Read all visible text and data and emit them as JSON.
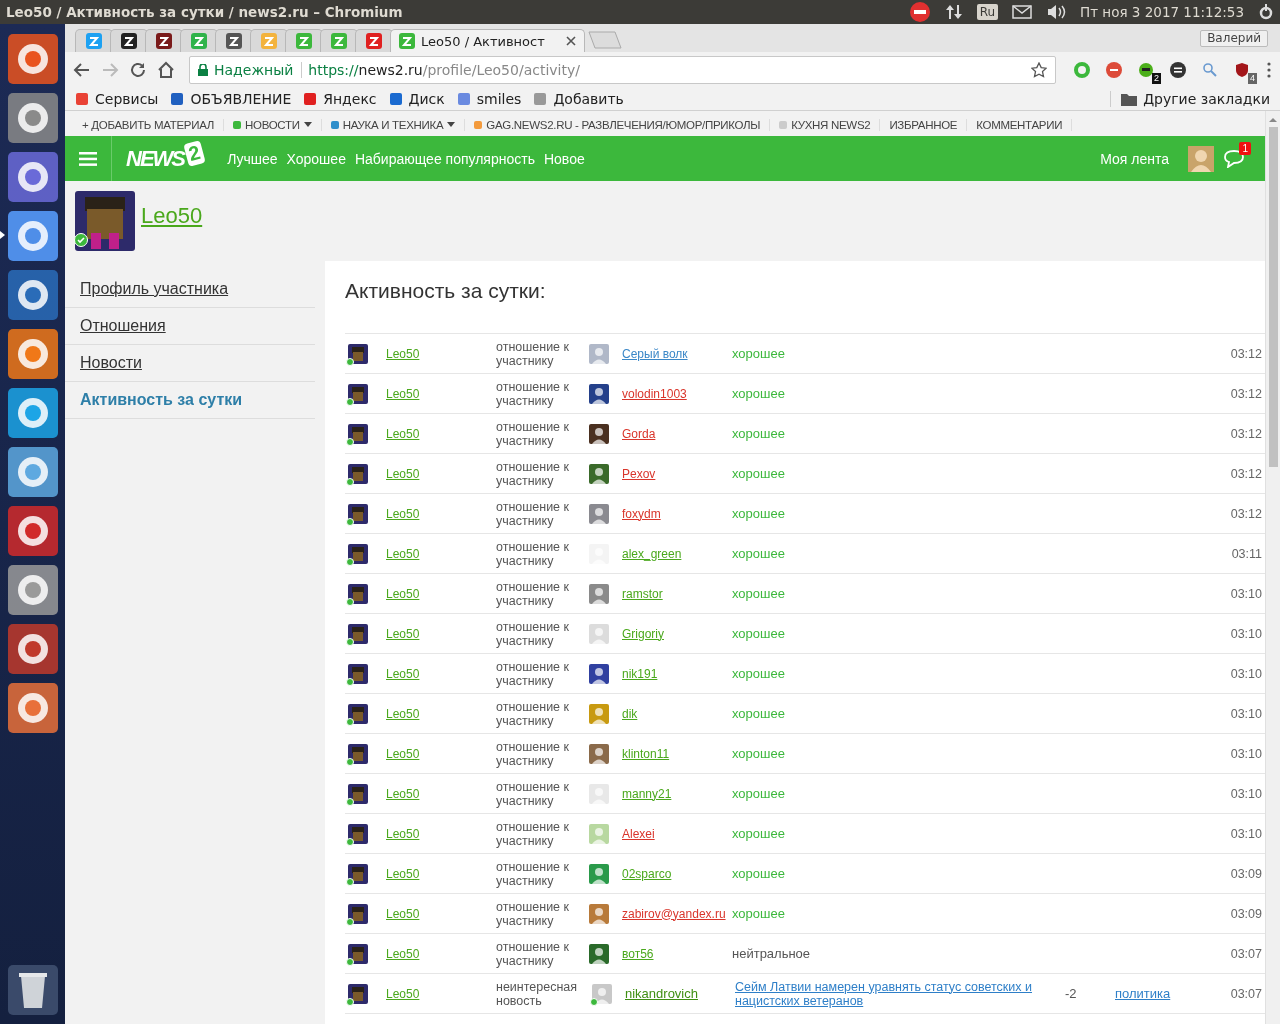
{
  "system_bar": {
    "title": "Leo50 / Активность за сутки / news2.ru – Chromium",
    "keyboard": "Ru",
    "clock": "Пт ноя  3 2017 11:12:53"
  },
  "launcher": {
    "items": [
      {
        "focused": false
      },
      {
        "focused": false
      },
      {
        "focused": false
      },
      {
        "focused": true
      },
      {
        "focused": false
      },
      {
        "focused": false
      },
      {
        "focused": false
      },
      {
        "focused": false
      },
      {
        "focused": false
      },
      {
        "focused": false
      },
      {
        "focused": false
      },
      {
        "focused": false
      }
    ]
  },
  "browser": {
    "tabs": [
      {
        "selected": false
      },
      {
        "selected": false
      },
      {
        "selected": false
      },
      {
        "selected": false
      },
      {
        "selected": false
      },
      {
        "selected": false
      },
      {
        "selected": false
      },
      {
        "selected": false
      },
      {
        "selected": false
      },
      {
        "title": "Leo50 / Активност",
        "selected": true
      }
    ],
    "profile": "Валерий",
    "security": "Надежный",
    "url": [
      "https://",
      "news2.ru",
      "/profile/Leo50/activity/"
    ],
    "extension_badges": [
      "2",
      "4"
    ],
    "bookmarks": [
      "Сервисы",
      "ОБЪЯВЛЕНИЕ",
      "Яндекс",
      "Диск",
      "smiles",
      "Добавить"
    ],
    "other_bookmarks": "Другие закладки"
  },
  "site_menu": [
    {
      "label": "+ ДОБАВИТЬ МАТЕРИАЛ",
      "dropdown": false
    },
    {
      "label": "НОВОСТИ",
      "color": "#3cb83c",
      "dropdown": true
    },
    {
      "label": "НАУКА И ТЕХНИКА",
      "color": "#2f8fcb",
      "dropdown": true
    },
    {
      "label": "GAG.NEWS2.RU - РАЗВЛЕЧЕНИЯ/ЮМОР/ПРИКОЛЫ",
      "color": "#f39a3c",
      "dropdown": false
    },
    {
      "label": "КУХНЯ NEWS2",
      "color": "#cccccc",
      "dropdown": false
    },
    {
      "label": "ИЗБРАННОЕ",
      "dropdown": false
    },
    {
      "label": "КОММЕНТАРИИ",
      "dropdown": false
    }
  ],
  "nav": {
    "logo": {
      "text": "NEWS",
      "mark": "2"
    },
    "links": [
      "Лучшее",
      "Хорошее",
      "Набирающее популярность",
      "Новое"
    ],
    "feed": "Моя лента",
    "messages_badge": "1"
  },
  "profile": {
    "name": "Leo50",
    "online": true
  },
  "sidebar": {
    "items": [
      {
        "label": "Профиль участника",
        "selected": false
      },
      {
        "label": "Отношения",
        "selected": false
      },
      {
        "label": "Новости",
        "selected": false
      },
      {
        "label": "Активность за сутки",
        "selected": true
      }
    ]
  },
  "activity": {
    "title": "Активность за сутки:",
    "rows": [
      {
        "kind": "relation",
        "actor": "Leo50",
        "action": "отношение к участнику",
        "target": "Серый волк",
        "color": "#3a87c7",
        "target_online": false,
        "result": "хорошее",
        "positive": true,
        "time": "03:12"
      },
      {
        "kind": "relation",
        "actor": "Leo50",
        "action": "отношение к участнику",
        "target": "volodin1003",
        "color": "#d9352b",
        "target_online": false,
        "result": "хорошее",
        "positive": true,
        "time": "03:12"
      },
      {
        "kind": "relation",
        "actor": "Leo50",
        "action": "отношение к участнику",
        "target": "Gorda",
        "color": "#d9352b",
        "target_online": false,
        "result": "хорошее",
        "positive": true,
        "time": "03:12"
      },
      {
        "kind": "relation",
        "actor": "Leo50",
        "action": "отношение к участнику",
        "target": "Pexov",
        "color": "#d9352b",
        "target_online": false,
        "result": "хорошее",
        "positive": true,
        "time": "03:12"
      },
      {
        "kind": "relation",
        "actor": "Leo50",
        "action": "отношение к участнику",
        "target": "foxydm",
        "color": "#d9352b",
        "target_online": false,
        "result": "хорошее",
        "positive": true,
        "time": "03:12"
      },
      {
        "kind": "relation",
        "actor": "Leo50",
        "action": "отношение к участнику",
        "target": "alex_green",
        "color": "#4aa81c",
        "target_online": false,
        "result": "хорошее",
        "positive": true,
        "time": "03:11"
      },
      {
        "kind": "relation",
        "actor": "Leo50",
        "action": "отношение к участнику",
        "target": "ramstor",
        "color": "#4aa81c",
        "target_online": false,
        "result": "хорошее",
        "positive": true,
        "time": "03:10"
      },
      {
        "kind": "relation",
        "actor": "Leo50",
        "action": "отношение к участнику",
        "target": "Grigoriy",
        "color": "#4aa81c",
        "target_online": false,
        "result": "хорошее",
        "positive": true,
        "time": "03:10"
      },
      {
        "kind": "relation",
        "actor": "Leo50",
        "action": "отношение к участнику",
        "target": "nik191",
        "color": "#4aa81c",
        "target_online": false,
        "result": "хорошее",
        "positive": true,
        "time": "03:10"
      },
      {
        "kind": "relation",
        "actor": "Leo50",
        "action": "отношение к участнику",
        "target": "dik",
        "color": "#4aa81c",
        "target_online": false,
        "result": "хорошее",
        "positive": true,
        "time": "03:10"
      },
      {
        "kind": "relation",
        "actor": "Leo50",
        "action": "отношение к участнику",
        "target": "klinton11",
        "color": "#4aa81c",
        "target_online": false,
        "result": "хорошее",
        "positive": true,
        "time": "03:10"
      },
      {
        "kind": "relation",
        "actor": "Leo50",
        "action": "отношение к участнику",
        "target": "manny21",
        "color": "#4aa81c",
        "target_online": false,
        "result": "хорошее",
        "positive": true,
        "time": "03:10"
      },
      {
        "kind": "relation",
        "actor": "Leo50",
        "action": "отношение к участнику",
        "target": "Alexei",
        "color": "#d9352b",
        "target_online": false,
        "result": "хорошее",
        "positive": true,
        "time": "03:10"
      },
      {
        "kind": "relation",
        "actor": "Leo50",
        "action": "отношение к участнику",
        "target": "02sparco",
        "color": "#4aa81c",
        "target_online": false,
        "result": "хорошее",
        "positive": true,
        "time": "03:09"
      },
      {
        "kind": "relation",
        "actor": "Leo50",
        "action": "отношение к участнику",
        "target": "zabirov@yandex.ru",
        "color": "#d9352b",
        "target_online": false,
        "result": "хорошее",
        "positive": true,
        "time": "03:09"
      },
      {
        "kind": "relation",
        "actor": "Leo50",
        "action": "отношение к участнику",
        "target": "вот56",
        "color": "#4aa81c",
        "target_online": false,
        "result": "нейтральное",
        "positive": false,
        "time": "03:07"
      },
      {
        "kind": "news",
        "actor": "Leo50",
        "action": "неинтересная новость",
        "target": "nikandrovich",
        "color": "#3f8f12",
        "target_online": true,
        "news_title": "Сейм Латвии намерен уравнять статус советских и нацистских ветеранов",
        "score": "-2",
        "category": "политика",
        "time": "03:07"
      }
    ]
  }
}
